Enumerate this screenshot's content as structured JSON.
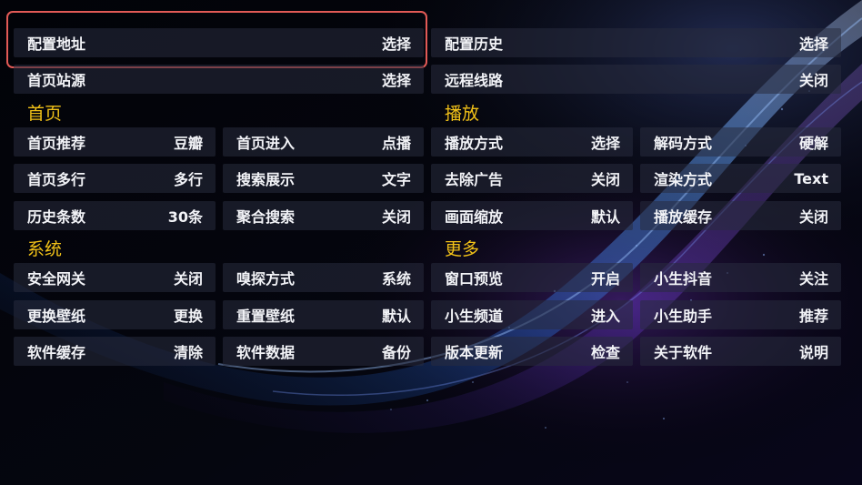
{
  "colors": {
    "background": "#030409",
    "section_title": "#f2c218",
    "focus_border": "#e25a56",
    "text": "#f2f3f7"
  },
  "top": [
    {
      "id": "config-address",
      "label": "配置地址",
      "value": "选择"
    },
    {
      "id": "config-history",
      "label": "配置历史",
      "value": "选择"
    },
    {
      "id": "home-source",
      "label": "首页站源",
      "value": "选择"
    },
    {
      "id": "remote-route",
      "label": "远程线路",
      "value": "关闭"
    }
  ],
  "sections": {
    "home": {
      "title": "首页",
      "items": [
        {
          "label": "首页推荐",
          "value": "豆瓣"
        },
        {
          "label": "首页进入",
          "value": "点播"
        },
        {
          "label": "首页多行",
          "value": "多行"
        },
        {
          "label": "搜索展示",
          "value": "文字"
        },
        {
          "label": "历史条数",
          "value": "30条"
        },
        {
          "label": "聚合搜索",
          "value": "关闭"
        }
      ]
    },
    "play": {
      "title": "播放",
      "items": [
        {
          "label": "播放方式",
          "value": "选择"
        },
        {
          "label": "解码方式",
          "value": "硬解"
        },
        {
          "label": "去除广告",
          "value": "关闭"
        },
        {
          "label": "渲染方式",
          "value": "Text"
        },
        {
          "label": "画面缩放",
          "value": "默认"
        },
        {
          "label": "播放缓存",
          "value": "关闭"
        }
      ]
    },
    "system": {
      "title": "系统",
      "items": [
        {
          "label": "安全网关",
          "value": "关闭"
        },
        {
          "label": "嗅探方式",
          "value": "系统"
        },
        {
          "label": "更换壁纸",
          "value": "更换"
        },
        {
          "label": "重置壁纸",
          "value": "默认"
        },
        {
          "label": "软件缓存",
          "value": "清除"
        },
        {
          "label": "软件数据",
          "value": "备份"
        }
      ]
    },
    "more": {
      "title": "更多",
      "items": [
        {
          "label": "窗口预览",
          "value": "开启"
        },
        {
          "label": "小生抖音",
          "value": "关注"
        },
        {
          "label": "小生频道",
          "value": "进入"
        },
        {
          "label": "小生助手",
          "value": "推荐"
        },
        {
          "label": "版本更新",
          "value": "检查"
        },
        {
          "label": "关于软件",
          "value": "说明"
        }
      ]
    }
  }
}
